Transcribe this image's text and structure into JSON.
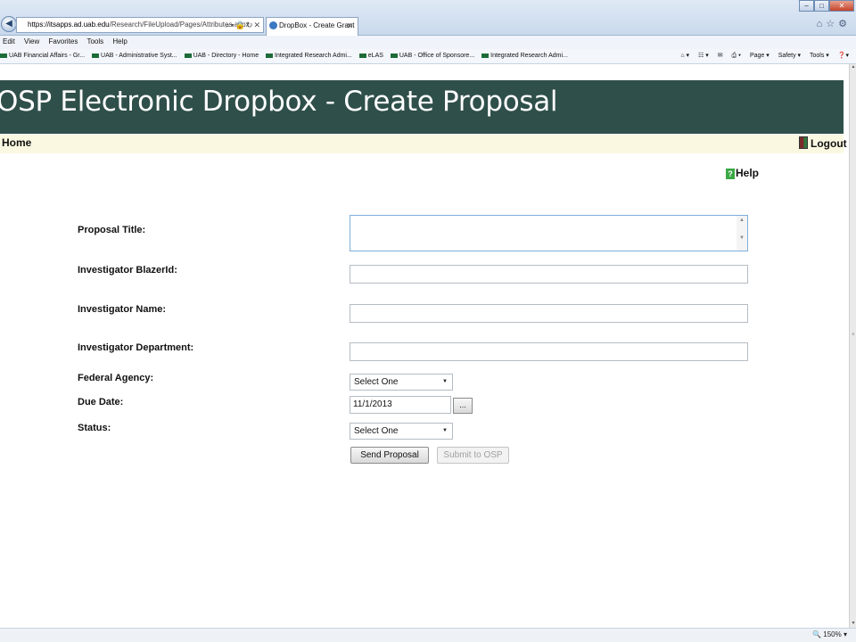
{
  "browser": {
    "address_host": "https://itsapps.ad.uab.edu",
    "address_path": "/Research/FileUpload/Pages/Attributes.aspx",
    "tab_title": "DropBox - Create Grant",
    "menu": [
      "Edit",
      "View",
      "Favorites",
      "Tools",
      "Help"
    ],
    "favorites": [
      "UAB Financial Affairs - Gr...",
      "UAB - Administrative Syst...",
      "UAB - Directory - Home",
      "Integrated Research Admi...",
      "eLAS",
      "UAB - Office of Sponsore...",
      "Integrated Research Admi..."
    ],
    "command_bar": [
      "Page ▾",
      "Safety ▾",
      "Tools ▾"
    ],
    "zoom": "150%"
  },
  "page": {
    "title": "OSP Electronic Dropbox - Create Proposal",
    "nav": {
      "home": "Home",
      "logout": "Logout"
    },
    "help": "Help"
  },
  "form": {
    "proposal_title_label": "Proposal Title:",
    "blazer_id_label": "Investigator BlazerId:",
    "investigator_name_label": "Investigator Name:",
    "investigator_department_label": "Investigator Department:",
    "federal_agency_label": "Federal Agency:",
    "federal_agency_value": "Select One",
    "due_date_label": "Due Date:",
    "due_date_value": "11/1/2013",
    "date_picker_label": "...",
    "status_label": "Status:",
    "status_value": "Select One",
    "send_label": "Send Proposal",
    "submit_label": "Submit to OSP"
  },
  "colors": {
    "header_bg": "#2f4f4a",
    "nav_bg": "#fbf8e2"
  }
}
